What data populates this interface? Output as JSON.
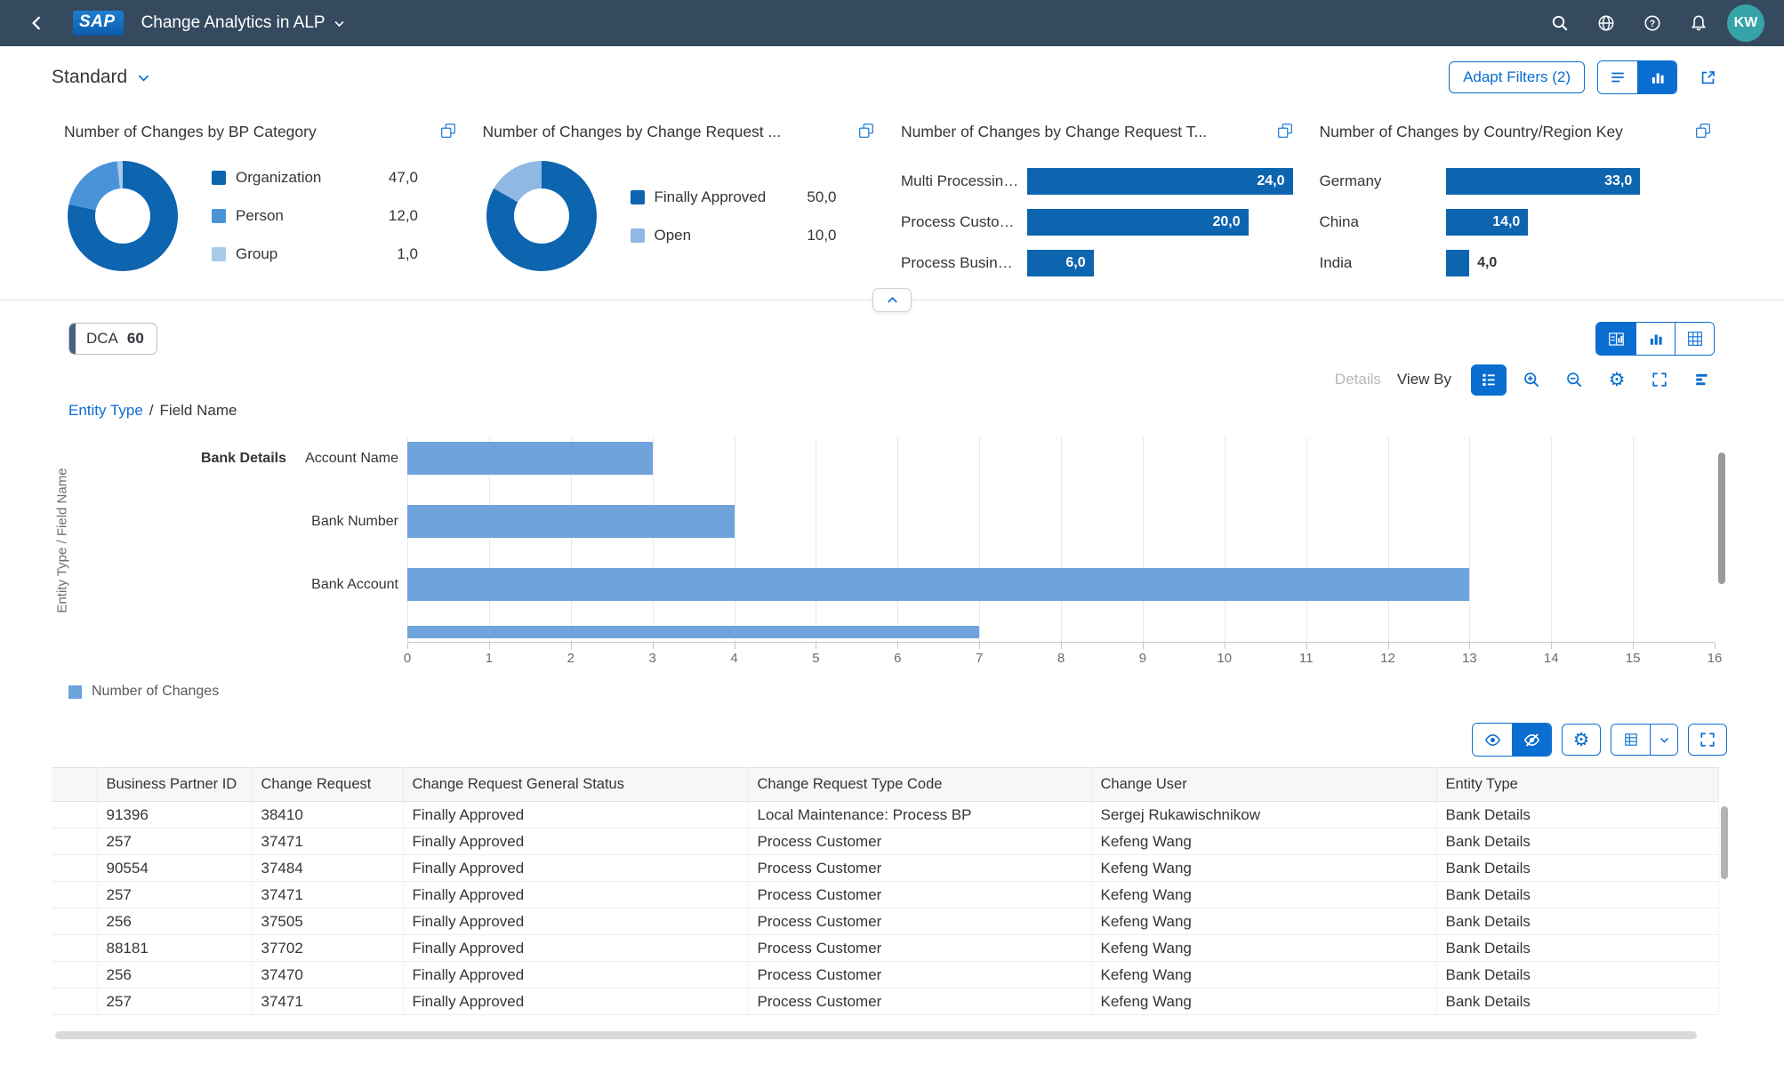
{
  "shell": {
    "logo_text": "SAP",
    "app_title": "Change Analytics in ALP",
    "avatar_initials": "KW"
  },
  "filter_bar": {
    "variant_title": "Standard",
    "adapt_filters_label": "Adapt Filters (2)"
  },
  "kpi_cards": [
    {
      "title": "Number of Changes by BP Category",
      "type": "donut",
      "segments": [
        {
          "label": "Organization",
          "value": "47,0",
          "num": 47,
          "pct": 78.33,
          "color": "#0d64af"
        },
        {
          "label": "Person",
          "value": "12,0",
          "num": 12,
          "pct": 20.0,
          "color": "#4a93d9"
        },
        {
          "label": "Group",
          "value": "1,0",
          "num": 1,
          "pct": 1.67,
          "color": "#a9c9ea"
        }
      ]
    },
    {
      "title": "Number of Changes by Change Request ...",
      "type": "donut",
      "segments": [
        {
          "label": "Finally Approved",
          "value": "50,0",
          "num": 50,
          "pct": 83.33,
          "color": "#0d64af"
        },
        {
          "label": "Open",
          "value": "10,0",
          "num": 10,
          "pct": 16.67,
          "color": "#8fb8e4"
        }
      ]
    },
    {
      "title": "Number of Changes by Change Request T...",
      "type": "bar",
      "axis_max": 24,
      "bar_color": "#0d64af",
      "bars": [
        {
          "label": "Multi Processing...",
          "value": "24,0",
          "num": 24
        },
        {
          "label": "Process Customer",
          "value": "20,0",
          "num": 20
        },
        {
          "label": "Process Busines...",
          "value": "6,0",
          "num": 6
        }
      ]
    },
    {
      "title": "Number of Changes by Country/Region Key",
      "type": "bar",
      "axis_max": 45,
      "bar_color": "#0d64af",
      "bars": [
        {
          "label": "Germany",
          "value": "33,0",
          "num": 33
        },
        {
          "label": "China",
          "value": "14,0",
          "num": 14
        },
        {
          "label": "India",
          "value": "4,0",
          "num": 4
        }
      ]
    }
  ],
  "chart_section": {
    "chip_label": "DCA",
    "chip_count": "60",
    "details_label": "Details",
    "view_by_label": "View By",
    "breadcrumb": {
      "link": "Entity Type",
      "separator": "/",
      "current": "Field Name"
    },
    "legend_label": "Number of Changes"
  },
  "chart_data": {
    "type": "bar",
    "orientation": "horizontal",
    "group": "Bank Details",
    "categories": [
      "Account Name",
      "Bank Number",
      "Bank Account"
    ],
    "values": [
      3,
      4,
      13
    ],
    "partial_next_value": 7,
    "series_name": "Number of Changes",
    "xlim": [
      0,
      16
    ],
    "x_ticks": [
      0,
      1,
      2,
      3,
      4,
      5,
      6,
      7,
      8,
      9,
      10,
      11,
      12,
      13,
      14,
      15,
      16
    ],
    "ylabel": "Entity Type / Field Name",
    "bar_color": "#6fa3dc",
    "grid": true,
    "legend_position": "bottom-left"
  },
  "table": {
    "columns": [
      "Business Partner ID",
      "Change Request",
      "Change Request General Status",
      "Change Request Type Code",
      "Change User",
      "Entity Type"
    ],
    "rows": [
      [
        "91396",
        "38410",
        "Finally Approved",
        "Local Maintenance: Process BP",
        "Sergej Rukawischnikow",
        "Bank Details"
      ],
      [
        "257",
        "37471",
        "Finally Approved",
        "Process Customer",
        "Kefeng Wang",
        "Bank Details"
      ],
      [
        "90554",
        "37484",
        "Finally Approved",
        "Process Customer",
        "Kefeng Wang",
        "Bank Details"
      ],
      [
        "257",
        "37471",
        "Finally Approved",
        "Process Customer",
        "Kefeng Wang",
        "Bank Details"
      ],
      [
        "256",
        "37505",
        "Finally Approved",
        "Process Customer",
        "Kefeng Wang",
        "Bank Details"
      ],
      [
        "88181",
        "37702",
        "Finally Approved",
        "Process Customer",
        "Kefeng Wang",
        "Bank Details"
      ],
      [
        "256",
        "37470",
        "Finally Approved",
        "Process Customer",
        "Kefeng Wang",
        "Bank Details"
      ],
      [
        "257",
        "37471",
        "Finally Approved",
        "Process Customer",
        "Kefeng Wang",
        "Bank Details"
      ]
    ]
  },
  "colors": {
    "shell_bg": "#354a5f",
    "accent": "#0a6ed1",
    "kpi_bar": "#0d64af",
    "chart_bar": "#6fa3dc",
    "avatar_bg": "#35a3a8"
  }
}
